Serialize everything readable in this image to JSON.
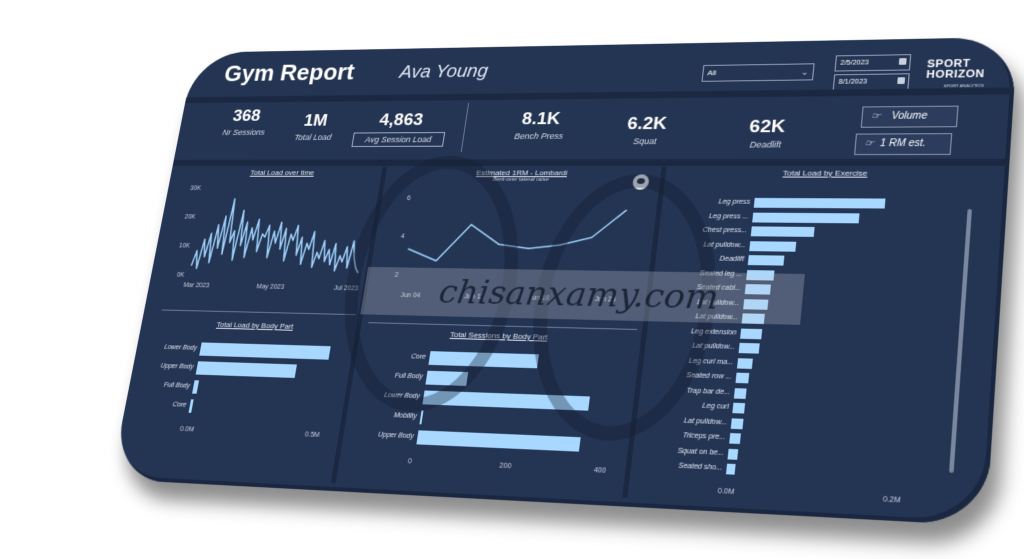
{
  "header": {
    "title": "Gym Report",
    "user": "Ava Young",
    "filter": {
      "selected": "All"
    },
    "date_from": "2/5/2023",
    "date_to": "8/1/2023",
    "logo": {
      "line1": "SPORT",
      "line2": "HORIZON",
      "tagline": "SPORT ANALYTICS"
    }
  },
  "kpis": [
    {
      "value": "368",
      "label": "Nr Sessions"
    },
    {
      "value": "1M",
      "label": "Total Load"
    },
    {
      "value": "4,863",
      "label": "Avg Session Load"
    },
    {
      "value": "8.1K",
      "label": "Bench Press"
    },
    {
      "value": "6.2K",
      "label": "Squat"
    },
    {
      "value": "62K",
      "label": "Deadlift"
    }
  ],
  "toggles": [
    {
      "label": "Volume",
      "icon": "pointing-hand-icon"
    },
    {
      "label": "1 RM est.",
      "icon": "pointing-hand-icon"
    }
  ],
  "watermark": "chisanxamy.com",
  "colors": {
    "background": "#243453",
    "bar": "#a8d8ff",
    "line": "#9fd2fb",
    "text": "#ffffff"
  },
  "chart_data": [
    {
      "id": "total-load-over-time",
      "type": "line",
      "title": "Total Load over time",
      "xlabel": "",
      "ylabel": "",
      "x_ticks": [
        "Mar 2023",
        "May 2023",
        "Jul 2023"
      ],
      "y_ticks": [
        "0K",
        "10K",
        "20K",
        "30K"
      ],
      "ylim": [
        0,
        30000
      ],
      "values": [
        3000,
        8000,
        2000,
        12000,
        6000,
        14000,
        4000,
        17000,
        9000,
        20000,
        7000,
        26000,
        11000,
        15000,
        5000,
        22000,
        10000,
        18000,
        6000,
        16000,
        12000,
        19000,
        8000,
        14000,
        13000,
        17000,
        6000,
        15000,
        11000,
        18000,
        9000,
        16000,
        5000,
        14000,
        12000,
        17000,
        7000,
        13000,
        4000,
        11000,
        9000,
        15000,
        3000,
        8000,
        6000,
        12000,
        5000,
        9000,
        4000,
        11000,
        2000,
        7000,
        5000,
        10000,
        3000,
        12000,
        6000,
        3000,
        1500
      ]
    },
    {
      "id": "estimated-1rm-lombardi",
      "type": "line",
      "title": "Estimated 1RM - Lombardi",
      "subtitle": "Bent-over lateral raise",
      "x_ticks": [
        "Jun 04",
        "Jun 11",
        "Jun 18",
        "Jun 25"
      ],
      "y_ticks": [
        "2",
        "4",
        "6"
      ],
      "ylim": [
        1.5,
        6.5
      ],
      "values": [
        3.3,
        2.7,
        4.6,
        3.6,
        3.4,
        3.6,
        4.0,
        5.4
      ]
    },
    {
      "id": "total-load-by-body-part",
      "type": "bar",
      "orientation": "horizontal",
      "title": "Total Load by Body Part",
      "categories": [
        "Lower Body",
        "Upper Body",
        "Full Body",
        "Core"
      ],
      "values": [
        0.52,
        0.4,
        0.02,
        0.01
      ],
      "x_ticks": [
        "0.0M",
        "0.5M"
      ],
      "xlim": [
        0,
        0.55
      ],
      "unit": "M"
    },
    {
      "id": "total-sessions-by-body-part",
      "type": "bar",
      "orientation": "horizontal",
      "title": "Total Sessions by Body Part",
      "categories": [
        "Core",
        "Full Body",
        "Lower Body",
        "Mobility",
        "Upper Body"
      ],
      "values": [
        240,
        90,
        360,
        2,
        350
      ],
      "x_ticks": [
        "0",
        "200",
        "400"
      ],
      "xlim": [
        0,
        420
      ]
    },
    {
      "id": "total-load-by-exercise",
      "type": "bar",
      "orientation": "horizontal",
      "title": "Total Load by Exercise",
      "categories": [
        "Leg press",
        "Leg press ...",
        "Chest press...",
        "Lat pulldow...",
        "Deadlift",
        "Seated leg ...",
        "Seated cabl...",
        "Lat pulldow...",
        "Lat pulldow...",
        "Leg extension",
        "Lat pulldow...",
        "Leg curl ma...",
        "Seated row ...",
        "Trap bar de...",
        "Leg curl",
        "Lat pulldow...",
        "Triceps pre...",
        "Squat on be...",
        "Seated sho..."
      ],
      "values": [
        0.165,
        0.135,
        0.08,
        0.058,
        0.045,
        0.035,
        0.032,
        0.03,
        0.028,
        0.027,
        0.025,
        0.019,
        0.016,
        0.015,
        0.014,
        0.014,
        0.013,
        0.012,
        0.011
      ],
      "x_ticks": [
        "0.0M",
        "0.2M"
      ],
      "xlim": [
        0,
        0.2
      ],
      "unit": "M"
    }
  ]
}
